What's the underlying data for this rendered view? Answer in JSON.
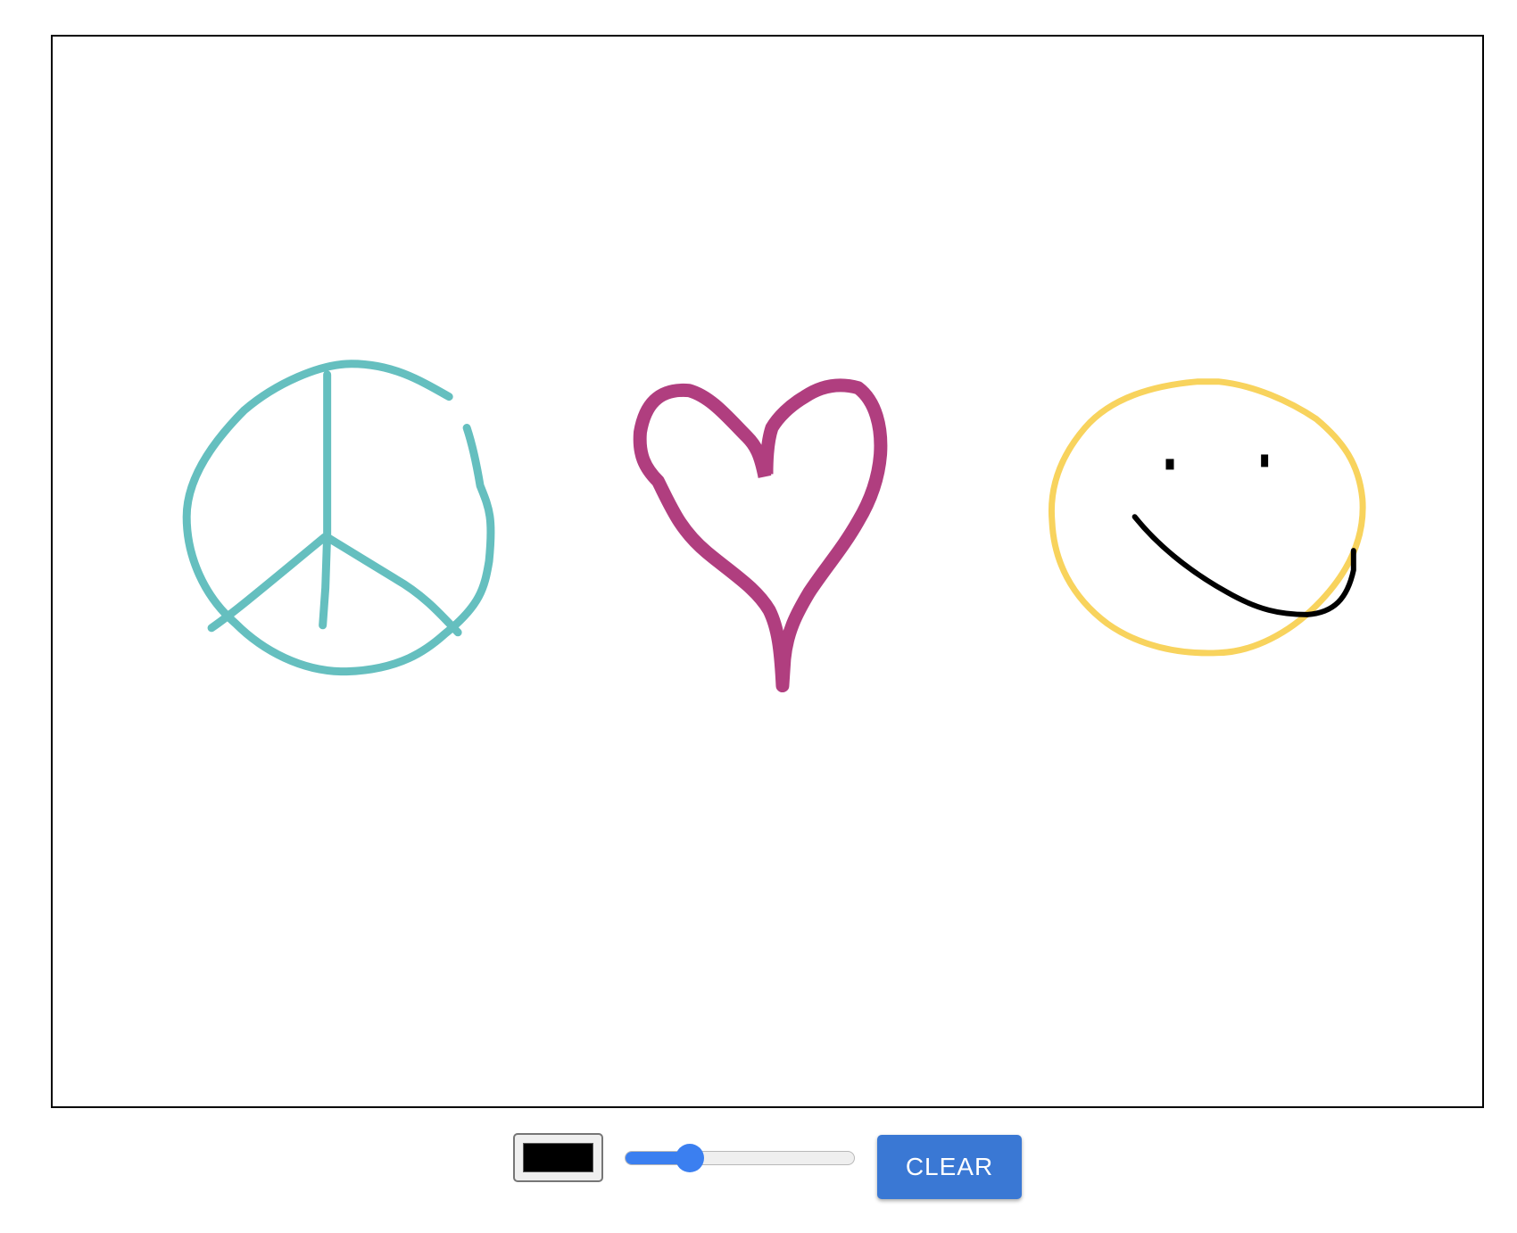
{
  "drawing": {
    "strokes": [
      {
        "name": "peace-sign",
        "color": "#65bfbf"
      },
      {
        "name": "heart",
        "color": "#b03e7f"
      },
      {
        "name": "smiley-face",
        "color": "#f8d35d"
      },
      {
        "name": "smile-and-eyes",
        "color": "#000000"
      }
    ]
  },
  "toolbar": {
    "color_value": "#000000",
    "brush_size_fraction": 0.25,
    "slider_fill_color": "#3b7ff0",
    "clear_label": "CLEAR",
    "clear_color": "#3a78d4"
  }
}
